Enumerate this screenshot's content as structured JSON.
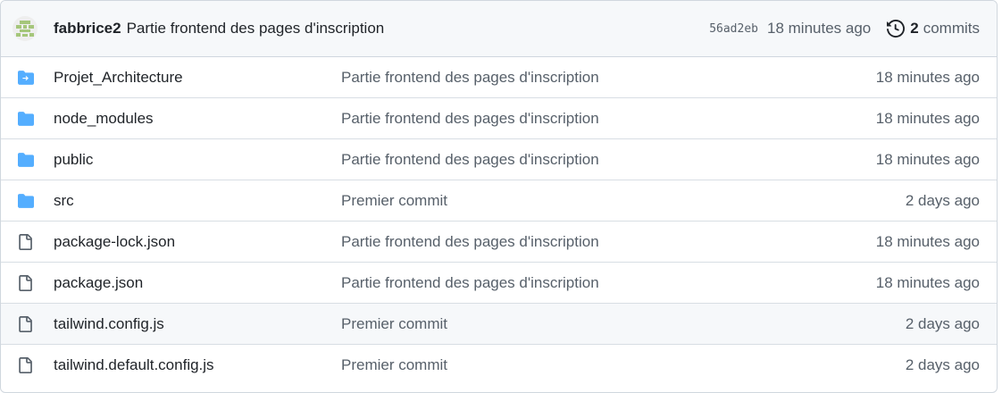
{
  "header": {
    "author": "fabbrice2",
    "message": "Partie frontend des pages d'inscription",
    "sha": "56ad2eb",
    "time": "18 minutes ago",
    "commits_count": "2",
    "commits_label": "commits"
  },
  "files": [
    {
      "name": "Projet_Architecture",
      "type": "submodule-folder",
      "message": "Partie frontend des pages d'inscription",
      "time": "18 minutes ago"
    },
    {
      "name": "node_modules",
      "type": "folder",
      "message": "Partie frontend des pages d'inscription",
      "time": "18 minutes ago"
    },
    {
      "name": "public",
      "type": "folder",
      "message": "Partie frontend des pages d'inscription",
      "time": "18 minutes ago"
    },
    {
      "name": "src",
      "type": "folder",
      "message": "Premier commit",
      "time": "2 days ago"
    },
    {
      "name": "package-lock.json",
      "type": "file",
      "message": "Partie frontend des pages d'inscription",
      "time": "18 minutes ago"
    },
    {
      "name": "package.json",
      "type": "file",
      "message": "Partie frontend des pages d'inscription",
      "time": "18 minutes ago"
    },
    {
      "name": "tailwind.config.js",
      "type": "file",
      "message": "Premier commit",
      "time": "2 days ago"
    },
    {
      "name": "tailwind.default.config.js",
      "type": "file",
      "message": "Premier commit",
      "time": "2 days ago"
    }
  ],
  "colors": {
    "folder": "#54aeff",
    "file_icon": "#57606a",
    "avatar": "#a5c67a"
  }
}
